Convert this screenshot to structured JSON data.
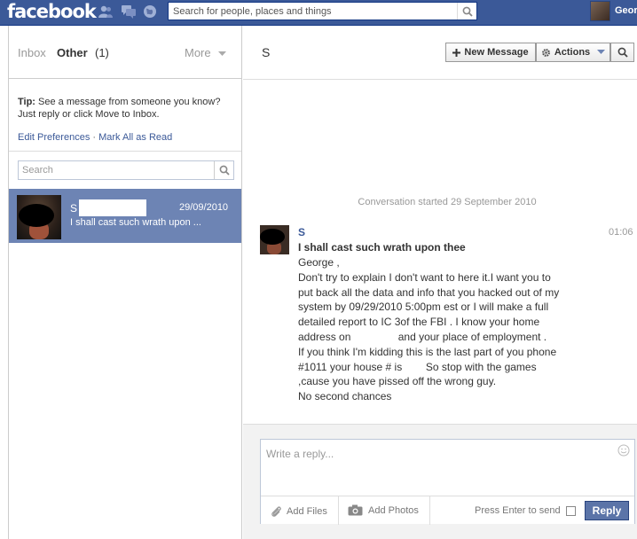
{
  "header": {
    "logo_text": "facebook",
    "search_placeholder": "Search for people, places and things",
    "profile_name": "Geor",
    "jewels": [
      "friends-icon",
      "messages-icon",
      "notifications-icon"
    ]
  },
  "left": {
    "tabs": {
      "inbox": "Inbox",
      "other": "Other",
      "other_count": "(1)",
      "more": "More"
    },
    "tip_label": "Tip:",
    "tip_text": " See a message from someone you know? Just reply or click Move to Inbox.",
    "links": {
      "edit_preferences": "Edit Preferences",
      "separator": " · ",
      "mark_all_read": "Mark All as Read"
    },
    "search_placeholder": "Search",
    "threads": [
      {
        "name": "S",
        "date": "29/09/2010",
        "snippet": "I shall cast such wrath upon ..."
      }
    ]
  },
  "right": {
    "title": "S",
    "buttons": {
      "new_message": "New Message",
      "actions": "Actions"
    },
    "conversation_started": "Conversation started 29 September 2010",
    "message": {
      "author": "S",
      "time": "01:06",
      "subject": "I shall cast such wrath upon thee",
      "body_lines": [
        "George ,",
        "Don't try to explain I don't want to here it.I want you to",
        "put back all the data and info that you hacked out of my",
        "system by 09/29/2010 5:00pm est or I will make a full",
        "detailed report to IC 3of the FBI . I know your home",
        "address on                and your place of employment .",
        "If you think I'm kidding this is the last part of you phone",
        "#1011 your house # is        So stop with the games",
        ",cause you have pissed off the wrong guy.",
        "No second chances"
      ]
    },
    "reply": {
      "placeholder": "Write a reply...",
      "add_files": "Add Files",
      "add_photos": "Add Photos",
      "press_enter": "Press Enter to send",
      "reply_button": "Reply"
    }
  }
}
